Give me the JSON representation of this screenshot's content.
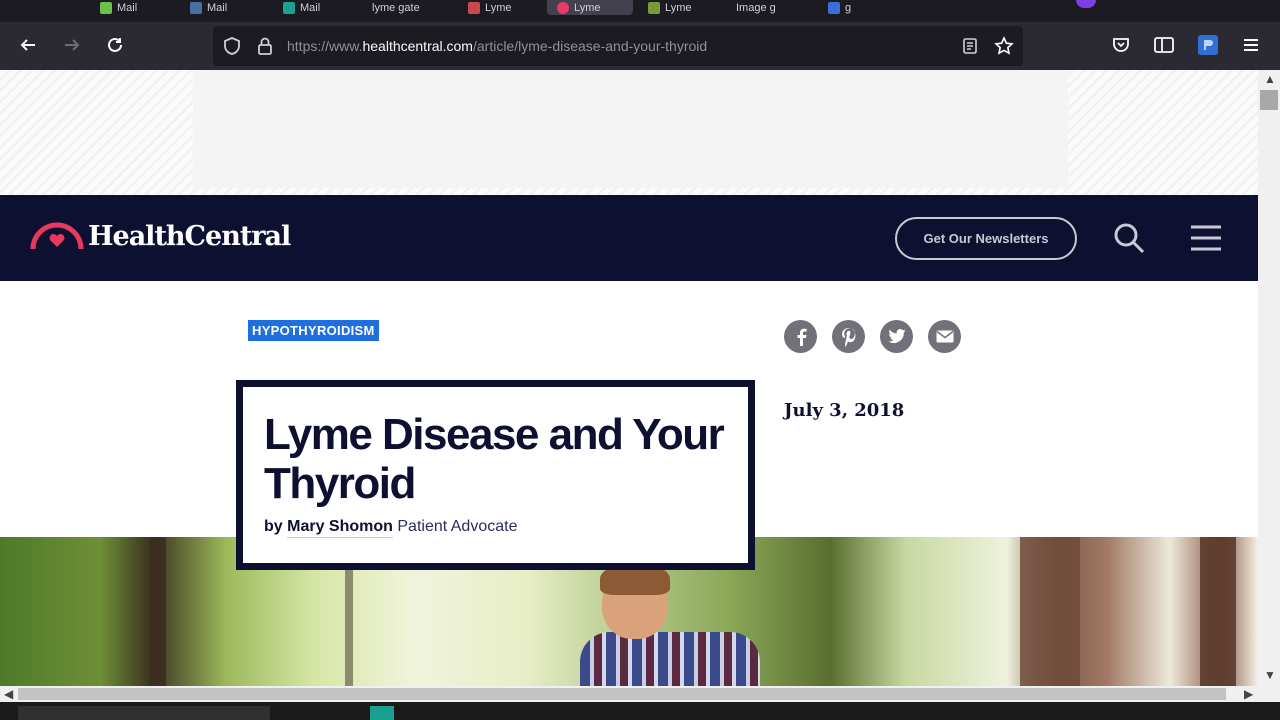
{
  "browser": {
    "tabs": [
      {
        "label": "Mail",
        "color": "#6bc04b"
      },
      {
        "label": "Mail",
        "color": "#4a6fa5"
      },
      {
        "label": "Mail",
        "color": "#1aa08f"
      },
      {
        "label": "lyme gate",
        "color": "#d9a54a"
      },
      {
        "label": "Lyme",
        "color": "#c94a4a"
      },
      {
        "label": "Lyme",
        "color": "#e83b67",
        "active": true
      },
      {
        "label": "Lyme",
        "color": "#7a9a3a"
      },
      {
        "label": "Image g",
        "color": "#777777"
      },
      {
        "label": "g",
        "color": "#3a6fd9"
      }
    ],
    "url": {
      "prefix": "https://www.",
      "domain": "healthcentral.com",
      "path": "/article/lyme-disease-and-your-thyroid"
    }
  },
  "site": {
    "logo": "HealthCentral",
    "newsletter_button": "Get Our Newsletters",
    "brand_color": "#0d1030",
    "accent_color": "#e8385c"
  },
  "article": {
    "category": "HYPOTHYROIDISM",
    "title": "Lyme Disease and Your Thyroid",
    "by": "by",
    "author": "Mary Shomon",
    "author_role": "Patient Advocate",
    "date": "July 3, 2018"
  },
  "social": [
    "facebook-icon",
    "pinterest-icon",
    "twitter-icon",
    "email-icon"
  ]
}
